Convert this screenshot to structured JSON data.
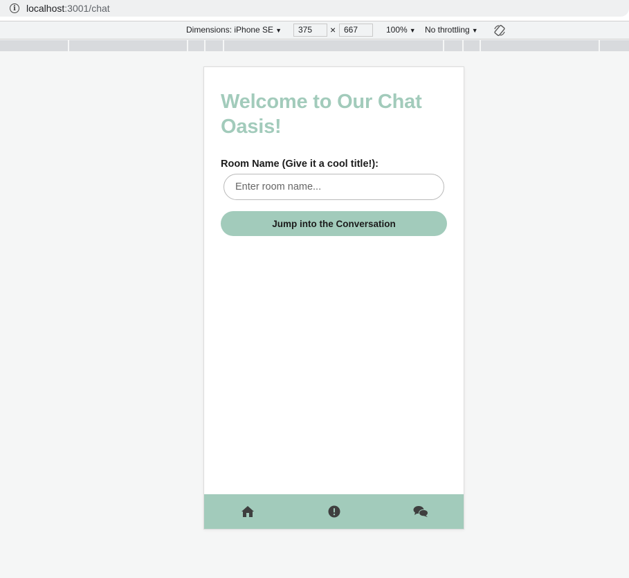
{
  "browser": {
    "url_host": "localhost",
    "url_path": ":3001/chat"
  },
  "devtools": {
    "dimensions_label": "Dimensions: iPhone SE",
    "width": "375",
    "height_value": "667",
    "times": "×",
    "zoom": "100%",
    "throttling": "No throttling"
  },
  "page": {
    "title": "Welcome to Our Chat Oasis!",
    "room_label": "Room Name (Give it a cool title!):",
    "room_input": {
      "value": "",
      "placeholder": "Enter room name..."
    },
    "join_button": "Jump into the Conversation"
  },
  "bottom_nav": {
    "items": [
      {
        "icon": "home-icon"
      },
      {
        "icon": "alert-icon"
      },
      {
        "icon": "comments-icon"
      }
    ]
  },
  "colors": {
    "accent": "#a2cbbb",
    "nav_icon": "#3f3f3f"
  }
}
